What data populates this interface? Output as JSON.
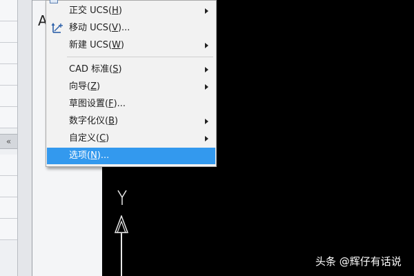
{
  "inner_panel": {
    "title_fragment": "A"
  },
  "left_panel": {
    "collapse_glyph": "«"
  },
  "menu": {
    "items": [
      {
        "label": "正交 UCS(H)",
        "mnemonic": "H",
        "prefix": "正交 UCS(",
        "suffix": ")",
        "submenu": true,
        "icon": ""
      },
      {
        "label": "移动 UCS(V)...",
        "mnemonic": "V",
        "prefix": "移动 UCS(",
        "suffix": ")...",
        "submenu": false,
        "icon": "move-ucs-icon"
      },
      {
        "label": "新建 UCS(W)",
        "mnemonic": "W",
        "prefix": "新建 UCS(",
        "suffix": ")",
        "submenu": true,
        "icon": ""
      },
      {
        "label": "CAD 标准(S)",
        "mnemonic": "S",
        "prefix": "CAD 标准(",
        "suffix": ")",
        "submenu": true,
        "icon": ""
      },
      {
        "label": "向导(Z)",
        "mnemonic": "Z",
        "prefix": "向导(",
        "suffix": ")",
        "submenu": true,
        "icon": ""
      },
      {
        "label": "草图设置(F)...",
        "mnemonic": "F",
        "prefix": "草图设置(",
        "suffix": ")...",
        "submenu": false,
        "icon": ""
      },
      {
        "label": "数字化仪(B)",
        "mnemonic": "B",
        "prefix": "数字化仪(",
        "suffix": ")",
        "submenu": true,
        "icon": ""
      },
      {
        "label": "自定义(C)",
        "mnemonic": "C",
        "prefix": "自定义(",
        "suffix": ")",
        "submenu": true,
        "icon": ""
      },
      {
        "label": "选项(N)...",
        "mnemonic": "N",
        "prefix": "选项(",
        "suffix": ")...",
        "submenu": false,
        "icon": "",
        "selected": true
      }
    ]
  },
  "canvas": {
    "ucs_axis_label": "Y"
  },
  "watermark": {
    "text": "头条 @辉仔有话说"
  },
  "colors": {
    "highlight": "#3399ee",
    "menu_bg": "#f2f2f2",
    "canvas_bg": "#000000"
  }
}
